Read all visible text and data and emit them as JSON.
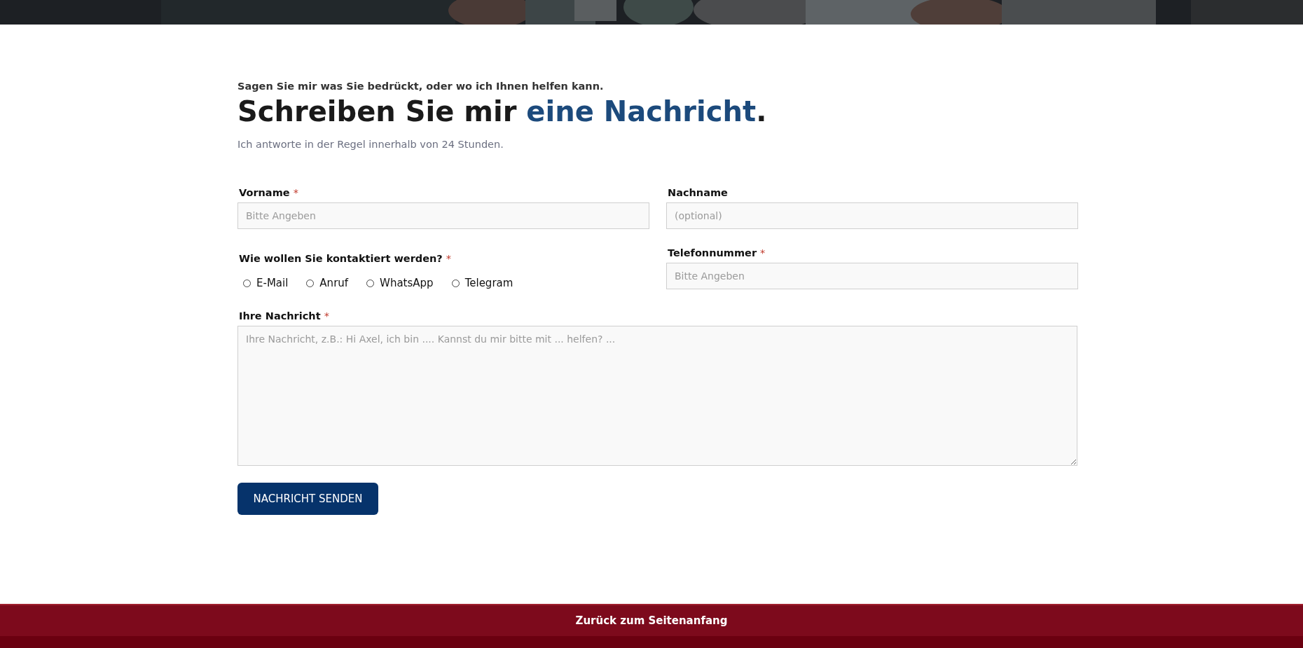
{
  "intro": {
    "eyebrow": "Sagen Sie mir was Sie bedrückt, oder wo ich Ihnen helfen kann.",
    "heading": [
      {
        "text": "Schreiben Sie mir ",
        "accent": false
      },
      {
        "text": "eine Nachricht",
        "accent": true
      },
      {
        "text": ".",
        "accent": false
      }
    ],
    "note": "Ich antworte in der Regel innerhalb von 24 Stunden."
  },
  "form": {
    "first_name": {
      "label": "Vorname",
      "required_mark": "*",
      "placeholder": "Bitte Angeben"
    },
    "last_name": {
      "label": "Nachname",
      "placeholder": "(optional)"
    },
    "contact": {
      "label": "Wie wollen Sie kontaktiert werden?",
      "required_mark": "*",
      "options": [
        {
          "label": "E-Mail",
          "selected": false
        },
        {
          "label": "Anruf",
          "selected": false
        },
        {
          "label": "WhatsApp",
          "selected": false
        },
        {
          "label": "Telegram",
          "selected": false
        }
      ]
    },
    "phone": {
      "label": "Telefonnummer",
      "required_mark": "*",
      "placeholder": "Bitte Angeben"
    },
    "message": {
      "label": "Ihre Nachricht",
      "required_mark": "*",
      "placeholder": "Ihre Nachricht, z.B.: Hi Axel, ich bin .... Kannst du mir bitte mit ... helfen? ..."
    },
    "submit": "NACHRICHT SENDEN"
  },
  "footer": {
    "link": "Zurück zum Seitenanfang"
  }
}
